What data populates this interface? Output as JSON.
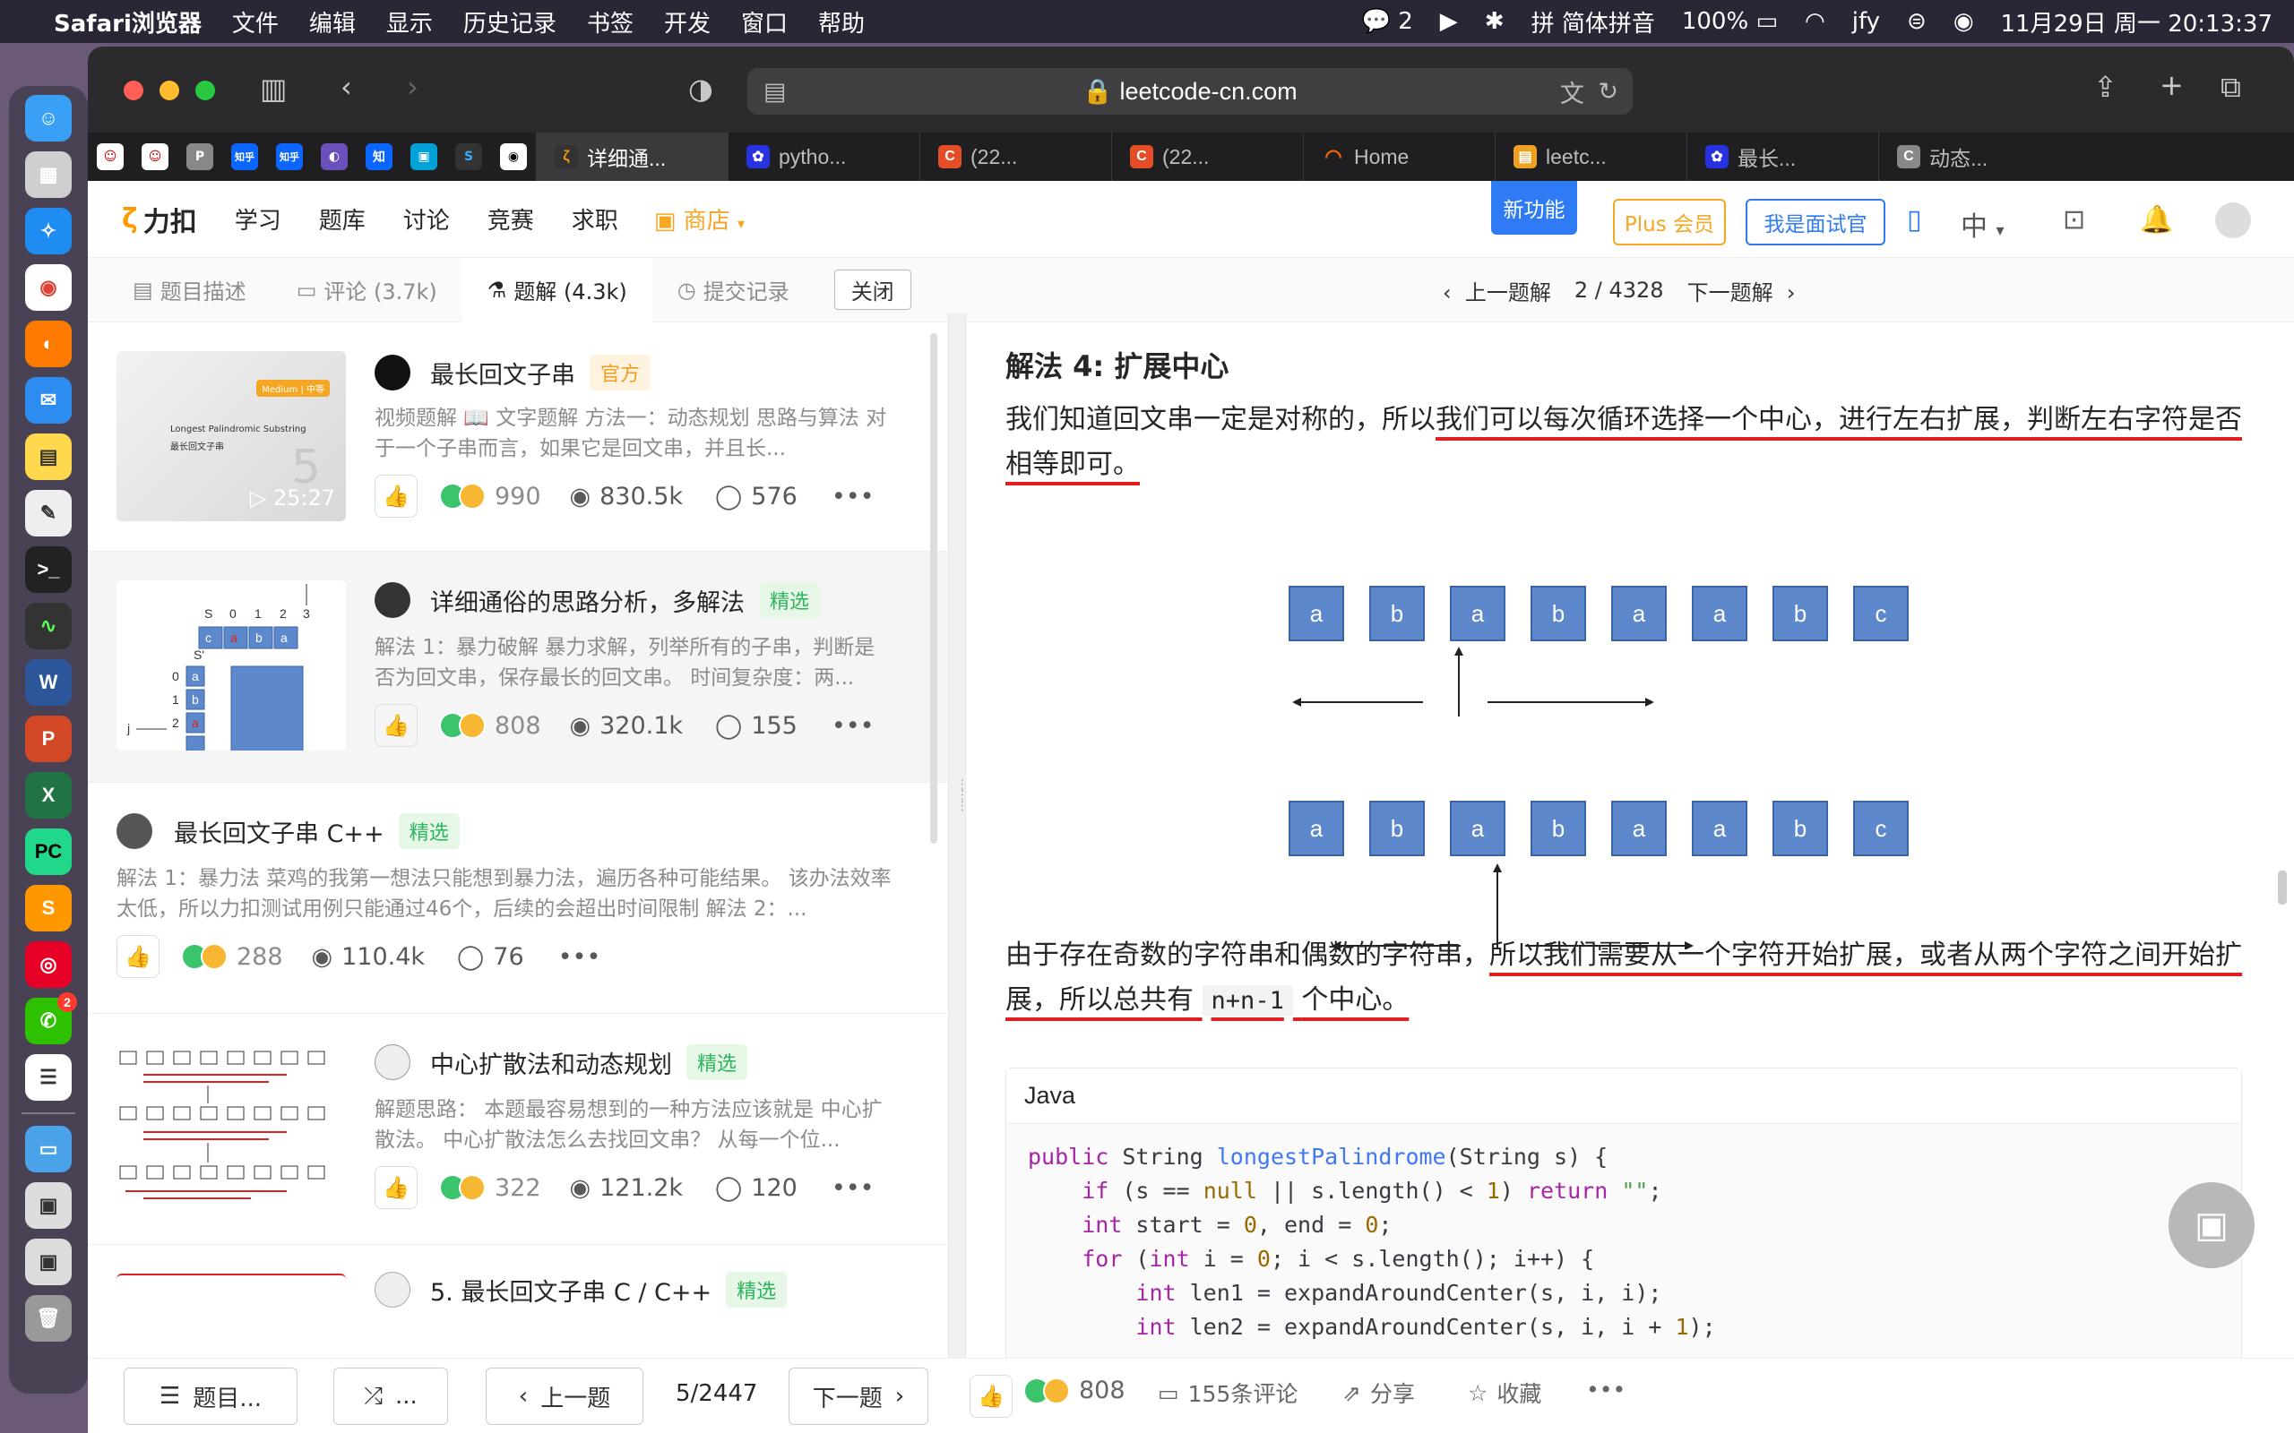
{
  "menubar": {
    "app": "Safari浏览器",
    "items": [
      "文件",
      "编辑",
      "显示",
      "历史记录",
      "书签",
      "开发",
      "窗口",
      "帮助"
    ],
    "wechat_count": "2",
    "ime": "简体拼音",
    "battery": "100%",
    "user": "jfy",
    "datetime": "11月29日 周一  20:13:37"
  },
  "dock": {
    "apps": [
      "finder",
      "launchpad",
      "safari",
      "chrome",
      "firefox",
      "mail",
      "notes",
      "textedit",
      "terminal",
      "activity",
      "word",
      "powerpoint",
      "excel",
      "pycharm",
      "sublime",
      "netease-music",
      "wechat",
      "reminders",
      "folder",
      "preview",
      "preview2",
      "trash"
    ],
    "wechat_badge": "2"
  },
  "browser": {
    "url": "leetcode-cn.com",
    "pinned_tabs": [
      "P",
      "知乎",
      "知乎",
      "知",
      "S"
    ],
    "tabs": [
      {
        "label": "详细通...",
        "active": true
      },
      {
        "label": "pytho..."
      },
      {
        "label": "(22..."
      },
      {
        "label": "(22..."
      },
      {
        "label": "Home"
      },
      {
        "label": "leetc..."
      },
      {
        "label": "最长..."
      },
      {
        "label": "动态..."
      }
    ]
  },
  "lc_nav": {
    "logo": "力扣",
    "items": [
      "学习",
      "题库",
      "讨论",
      "竞赛",
      "求职"
    ],
    "shop": "商店",
    "new_feature": "新功能",
    "plus": "Plus 会员",
    "interviewer": "我是面试官",
    "lang": "中"
  },
  "subtabs": {
    "desc": "题目描述",
    "comments": "评论 (3.7k)",
    "solutions": "题解 (4.3k)",
    "submissions": "提交记录",
    "close": "关闭",
    "prev": "上一题解",
    "pager": "2 / 4328",
    "next": "下一题解"
  },
  "solutions": [
    {
      "title": "最长回文子串",
      "tag": "官方",
      "tag_color": "orange",
      "desc": "视频题解 📖 文字题解 方法一：动态规划 思路与算法 对于一个子串而言，如果它是回文串，并且长...",
      "likes": "990",
      "views": "830.5k",
      "comments": "576",
      "duration": "25:27",
      "thumb_level": "Medium | 中等",
      "thumb_title": "Longest Palindromic Substring",
      "thumb_subtitle": "最长回文子串",
      "thumb_num": "5"
    },
    {
      "title": "详细通俗的思路分析，多解法",
      "tag": "精选",
      "tag_color": "green",
      "desc": "解法 1：暴力破解 暴力求解，列举所有的子串，判断是否为回文串，保存最长的回文串。 时间复杂度：两...",
      "likes": "808",
      "views": "320.1k",
      "comments": "155"
    },
    {
      "title": "最长回文子串 C++",
      "tag": "精选",
      "tag_color": "green",
      "desc": "解法 1：暴力法 菜鸡的我第一想法只能想到暴力法，遍历各种可能结果。 该办法效率太低，所以力扣测试用例只能通过46个，后续的会超出时间限制 解法 2：...",
      "likes": "288",
      "views": "110.4k",
      "comments": "76"
    },
    {
      "title": "中心扩散法和动态规划",
      "tag": "精选",
      "tag_color": "green",
      "desc": "解题思路： 本题最容易想到的一种方法应该就是 中心扩散法。 中心扩散法怎么去找回文串？ 从每一个位...",
      "likes": "322",
      "views": "121.2k",
      "comments": "120"
    },
    {
      "title": "5. 最长回文子串 C / C++",
      "tag": "精选",
      "tag_color": "green"
    }
  ],
  "article": {
    "heading": "解法 4: 扩展中心",
    "p1_a": "我们知道回文串一定是对称的，所以",
    "p1_b": "我们可以每次循环选择一个中心，进行左右扩展，判断左右字符是否相等即可。",
    "row1": [
      "a",
      "b",
      "a",
      "b",
      "a",
      "a",
      "b",
      "c"
    ],
    "row2": [
      "a",
      "b",
      "a",
      "b",
      "a",
      "a",
      "b",
      "c"
    ],
    "p2_a": "由于存在奇数的字符串和偶数的字符串，",
    "p2_b": "所以我们需要从一个字符开始扩展，或者从两个字符之间开始扩展，所以总共有",
    "p2_code": "n+n-1",
    "p2_c": "个中心。",
    "code_lang": "Java"
  },
  "bottom": {
    "list": "题目...",
    "random": "...",
    "prev": "上一题",
    "page": "5/2447",
    "next": "下一题",
    "likes": "808",
    "comments": "155条评论",
    "share": "分享",
    "favorite": "收藏"
  },
  "colors": {
    "accent": "#2f7bf5",
    "shop": "#f5a623",
    "green_tag": "#2db55d",
    "underline": "#e02020",
    "box": "#5d88cc"
  }
}
